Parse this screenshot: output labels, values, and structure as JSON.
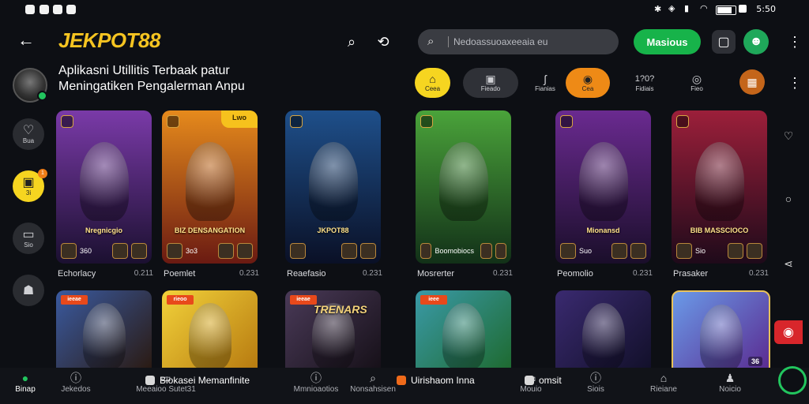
{
  "status_bar": {
    "time": "5:50"
  },
  "header": {
    "logo": "JEKPOT88",
    "search_placeholder": "Nedoassuoaxeeaia eu",
    "cta_label": "Masious",
    "back_icon": "back-arrow-icon",
    "search_icon": "search-icon",
    "history_icon": "history-search-icon"
  },
  "subtitle": {
    "line1": "Aplikasni Utillitis Terbaak patur",
    "line2": "Meningatiken Pengalerman Anpu"
  },
  "chips": [
    {
      "label": "Ceea",
      "icon": "home-icon"
    },
    {
      "label": "Fieado",
      "icon": "gift-icon"
    },
    {
      "label": "Fianias",
      "icon": "bag-icon"
    },
    {
      "label": "Cea",
      "icon": "games-icon"
    },
    {
      "label": "Fidiais",
      "icon": "history-icon",
      "value": "1?0?"
    },
    {
      "label": "Fieo",
      "icon": "chat-icon"
    }
  ],
  "left_rail": [
    {
      "label": "Bua",
      "icon": "heart-icon"
    },
    {
      "label": "3i",
      "icon": "gift-icon",
      "badge": "1"
    },
    {
      "label": "Sio",
      "icon": "tv-icon"
    },
    {
      "label": "",
      "icon": "avatar-icon"
    }
  ],
  "cards_row1": [
    {
      "title": "Nregnicgio",
      "foot": "360",
      "name": "Echorlacy",
      "value": "0.211",
      "bg": [
        "#7a3aa8",
        "#1b1030"
      ]
    },
    {
      "title": "BIZ DENSANGATION",
      "foot": "3o3",
      "name": "Poemlet",
      "value": "0.231",
      "bg": [
        "#e68a1c",
        "#6a1a12"
      ],
      "ribbon": "Lwo"
    },
    {
      "title": "JKPOT88",
      "foot": "",
      "name": "Reaefasio",
      "value": "0.231",
      "bg": [
        "#1e4f8a",
        "#0a1026"
      ]
    },
    {
      "title": "",
      "foot": "Boomobiocs",
      "name": "Mosrerter",
      "value": "0.231",
      "bg": [
        "#4aa33a",
        "#123018"
      ]
    },
    {
      "title": "Mionansd",
      "foot": "Suo",
      "name": "Peomolio",
      "value": "0.231",
      "bg": [
        "#6a2a90",
        "#1a0e2a"
      ]
    },
    {
      "title": "BIB MASSCIOCO",
      "foot": "Sio",
      "name": "Prasaker",
      "value": "0.231",
      "bg": [
        "#9c1f3a",
        "#1e0a1a"
      ]
    }
  ],
  "cards_row2": [
    {
      "tag": "ieeae",
      "bg": [
        "#3a5aa0",
        "#2a1a12"
      ]
    },
    {
      "tag": "rieoo",
      "bg": [
        "#f2d23a",
        "#b77a10"
      ]
    },
    {
      "tag": "ieeae",
      "title": "TRENARS",
      "bg": [
        "#4a3a58",
        "#161018"
      ]
    },
    {
      "tag": "ieee",
      "bg": [
        "#3a9aa8",
        "#1e6a30"
      ]
    },
    {
      "tag": "",
      "bg": [
        "#3a2a70",
        "#12102a"
      ]
    },
    {
      "tag": "",
      "foot": "36",
      "bg": [
        "#6a9ae8",
        "#5a2a90"
      ]
    }
  ],
  "bottom_nav": [
    {
      "label": "Binap",
      "icon": "home-icon",
      "active": true
    },
    {
      "label": "Jekedos",
      "icon": "lock-icon"
    },
    {
      "label": "Meeaioo Sutet31",
      "icon": "chat-icon"
    },
    {
      "label": "Mmnioaotios",
      "icon": "help-icon"
    },
    {
      "label": "Nonsahsisen",
      "icon": "search-icon"
    },
    {
      "label": "Mouio",
      "icon": "chat-icon"
    },
    {
      "label": "Siois",
      "icon": "info-icon"
    },
    {
      "label": "Rieiane",
      "icon": "bag-icon"
    },
    {
      "label": "Noicio",
      "icon": "profile-icon"
    }
  ],
  "bottom_strip": [
    {
      "text": "Biokasei Memanfinite"
    },
    {
      "text": "Uirishaom Inna"
    },
    {
      "text": "omsit"
    }
  ],
  "colors": {
    "accent": "#f6d520",
    "green": "#17b34a",
    "orange": "#ee8a16",
    "red": "#d8262b"
  }
}
